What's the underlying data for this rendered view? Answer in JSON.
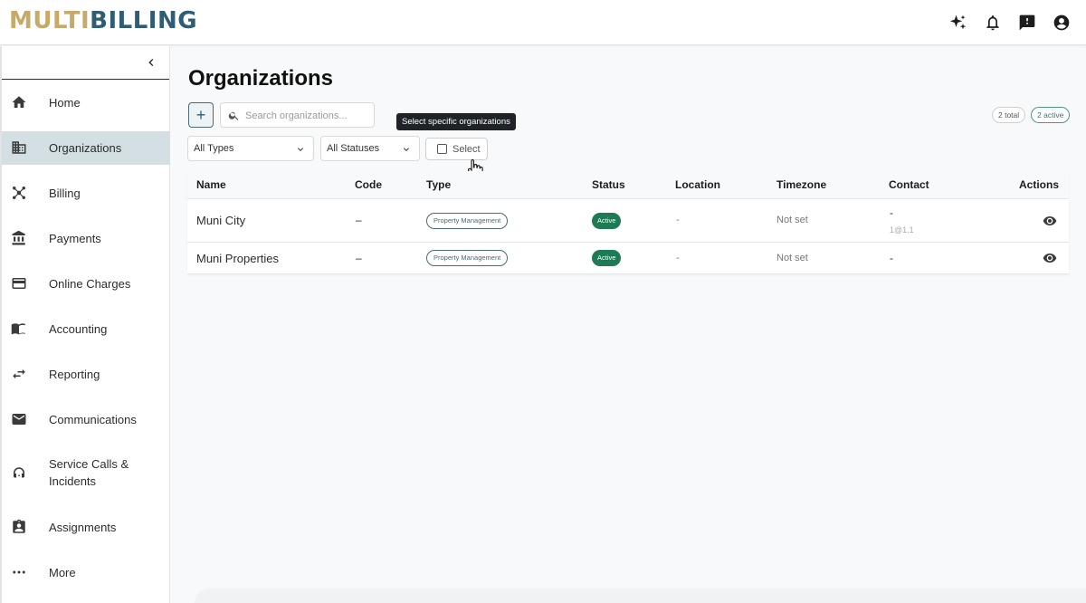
{
  "app": {
    "logo_part1": "MULTI",
    "logo_part2": "BILLING",
    "colors": {
      "brand_gold": "#c7a96a",
      "brand_blue": "#2f5d73",
      "active_nav_bg": "#d3dfe3",
      "status_active": "#1d7a55"
    }
  },
  "topbar": {
    "icons": [
      "sparkle-icon",
      "bell-icon",
      "feedback-icon",
      "account-icon"
    ]
  },
  "sidebar": {
    "items": [
      {
        "label": "Home",
        "icon": "home-icon"
      },
      {
        "label": "Organizations",
        "icon": "building-icon",
        "active": true
      },
      {
        "label": "Billing",
        "icon": "network-icon"
      },
      {
        "label": "Payments",
        "icon": "bank-icon"
      },
      {
        "label": "Online Charges",
        "icon": "credit-card-icon"
      },
      {
        "label": "Accounting",
        "icon": "book-icon"
      },
      {
        "label": "Reporting",
        "icon": "swap-icon"
      },
      {
        "label": "Communications",
        "icon": "mail-icon"
      },
      {
        "label": "Service Calls &",
        "label2": "Incidents",
        "icon": "support-agent-icon"
      },
      {
        "label": "Assignments",
        "icon": "assignment-icon"
      },
      {
        "label": "More",
        "icon": "more-icon"
      }
    ]
  },
  "main": {
    "title": "Organizations",
    "add_label": "+",
    "search_placeholder": "Search organizations...",
    "tooltip": "Select specific organizations",
    "badge_total": "2 total",
    "badge_active": "2 active",
    "filter_types": "All Types",
    "filter_statuses": "All Statuses",
    "select_label": "Select"
  },
  "table": {
    "columns": [
      "Name",
      "Code",
      "Type",
      "Status",
      "Location",
      "Timezone",
      "Contact",
      "Actions"
    ],
    "rows": [
      {
        "name": "Muni City",
        "code": "–",
        "type": "Property Management",
        "status": "Active",
        "location": "-",
        "timezone": "Not set",
        "contact": "-",
        "contact_sub": "1@1.1"
      },
      {
        "name": "Muni Properties",
        "code": "–",
        "type": "Property Management",
        "status": "Active",
        "location": "-",
        "timezone": "Not set",
        "contact": "-",
        "contact_sub": ""
      }
    ]
  }
}
